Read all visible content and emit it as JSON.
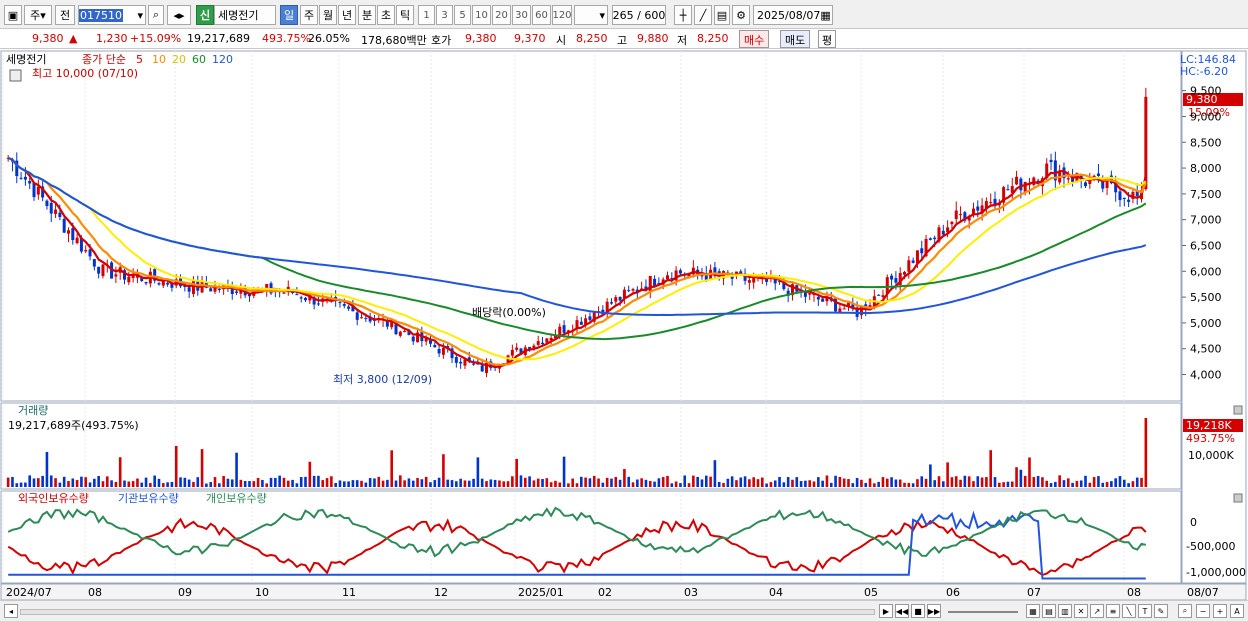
{
  "toolbar": {
    "period_week": "주",
    "prev_label": "전",
    "code_value": "017510",
    "stock_badge": "신",
    "stock_name": "세명전기",
    "tf_day": "일",
    "tf_week": "주",
    "tf_month": "월",
    "tf_year": "년",
    "tf_min": "분",
    "tf_sec": "초",
    "tf_tick": "틱",
    "nums": [
      "1",
      "3",
      "5",
      "10",
      "20",
      "30",
      "60",
      "120"
    ],
    "count_label": "265 / 600",
    "date_value": "2025/08/07"
  },
  "quote": {
    "price": "9,380",
    "arrow": "▲",
    "change": "1,230",
    "change_pct": "+15.09%",
    "volume": "19,217,689",
    "vol_ratio": "493.75%",
    "turnover": "26.05%",
    "amount": "178,680백만",
    "hoga_label": "호가",
    "ask": "9,380",
    "bid": "9,370",
    "open_label": "시",
    "open": "8,250",
    "high_label": "고",
    "high": "9,880",
    "low_label": "저",
    "low": "8,250",
    "buy_label": "매수",
    "sell_label": "매도",
    "avg_label": "평"
  },
  "price_panel": {
    "legend_name": "세명전기",
    "legend_ma_title": "종가 단순",
    "ma_periods": [
      "5",
      "10",
      "20",
      "60",
      "120"
    ],
    "ma_colors": [
      "#d40000",
      "#ff8c00",
      "#ffee00",
      "#1a8a2a",
      "#2255dd"
    ],
    "lc_label": "LC:146.84",
    "hc_label": "HC:-6.20",
    "price_tag": "9,380",
    "pct_tag": "15.09%",
    "high_note": "최고 10,000 (07/10)",
    "low_note": "최저 3,800 (12/09)",
    "div_note": "배당락(0.00%)",
    "yaxis": [
      "9,500",
      "9,000",
      "8,500",
      "8,000",
      "7,500",
      "7,000",
      "6,500",
      "6,000",
      "5,500",
      "5,000",
      "4,500",
      "4,000"
    ]
  },
  "volume_panel": {
    "title": "거래량",
    "value_label": "19,217,689주(493.75%)",
    "tag_value": "19,218K",
    "tag_pct": "493.75%",
    "yaxis": [
      "10,000K"
    ]
  },
  "holdings_panel": {
    "legend": [
      "외국인보유수량",
      "기관보유수량",
      "개인보유수량"
    ],
    "colors": [
      "#d40000",
      "#2255dd",
      "#2e8b57"
    ],
    "yaxis": [
      "0",
      "-500,000",
      "-1,000,000"
    ]
  },
  "xaxis": [
    "2024/07",
    "08",
    "09",
    "10",
    "11",
    "12",
    "2025/01",
    "02",
    "03",
    "04",
    "05",
    "06",
    "07",
    "08",
    "08/07"
  ],
  "chart_data": {
    "type": "candlestick",
    "title": "세명전기",
    "x": [
      "2024/07",
      "08",
      "09",
      "10",
      "11",
      "12",
      "2025/01",
      "02",
      "03",
      "04",
      "05",
      "06",
      "07",
      "08"
    ],
    "close_approx": [
      8200,
      6000,
      5700,
      5600,
      5000,
      4100,
      5000,
      6000,
      5800,
      5200,
      7000,
      8000,
      7400,
      9380
    ],
    "ylim": [
      3700,
      9900
    ],
    "last_close": 9380,
    "volume_last": 19217689
  }
}
